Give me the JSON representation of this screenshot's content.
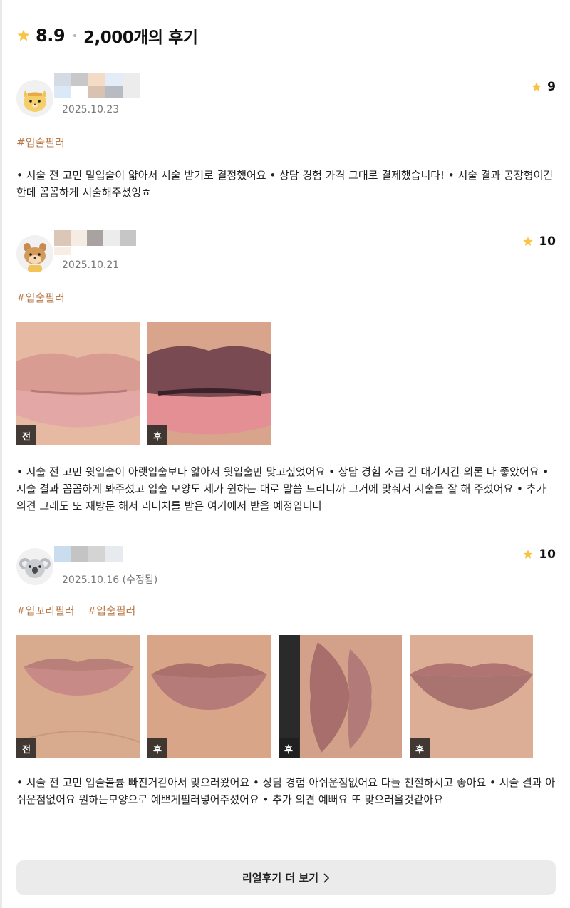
{
  "header": {
    "score": "8.9",
    "count": "2,000개의 후기"
  },
  "reviews": [
    {
      "date": "2025.10.23",
      "rating": "9",
      "tags": [
        "#입술필러"
      ],
      "text": "• 시술 전 고민 밑입술이 얇아서 시술 받기로 결정했어요 • 상담 경험 가격 그대로 결제했습니다! • 시술 결과 공장형이긴한데 꼼꼼하게 시술해주셨엉ㅎ",
      "avatar": "cat-avatar-icon",
      "photos": []
    },
    {
      "date": "2025.10.21",
      "rating": "10",
      "tags": [
        "#입술필러"
      ],
      "text": "• 시술 전 고민 윗입술이 아랫입술보다 얇아서 윗입술만 맞고싶었어요 • 상담 경험 조금 긴 대기시간 외론 다 좋았어요 • 시술 결과 꼼꼼하게 봐주셨고 입술 모양도 제가 원하는 대로 말씀 드리니까 그거에 맞춰서 시술을 잘 해 주셨어요 • 추가 의견 그래도 또 재방문 해서 리터치를 받은 여기에서 받을 예정입니다",
      "avatar": "squirrel-avatar-icon",
      "photos": [
        {
          "label": "전"
        },
        {
          "label": "후"
        }
      ]
    },
    {
      "date": "2025.10.16 (수정됨)",
      "rating": "10",
      "tags": [
        "#입꼬리필러",
        "#입술필러"
      ],
      "text": "• 시술 전 고민 입술볼륨 빠진거같아서 맞으러왔어요 • 상담 경험 아쉬운점없어요 다들 친절하시고 좋아요 • 시술 결과 아쉬운점없어요 원하는모양으로 예쁘게필러넣어주셨어요 • 추가 의견 예뻐요 또 맞으러올것같아요",
      "avatar": "koala-avatar-icon",
      "photos": [
        {
          "label": "전"
        },
        {
          "label": "후"
        },
        {
          "label": "후"
        },
        {
          "label": "후"
        }
      ]
    }
  ],
  "more_button": {
    "label": "리얼후기 더 보기"
  },
  "colors": {
    "star": "#f7c444",
    "tag": "#b97a4a",
    "button_bg": "#ebebec"
  }
}
